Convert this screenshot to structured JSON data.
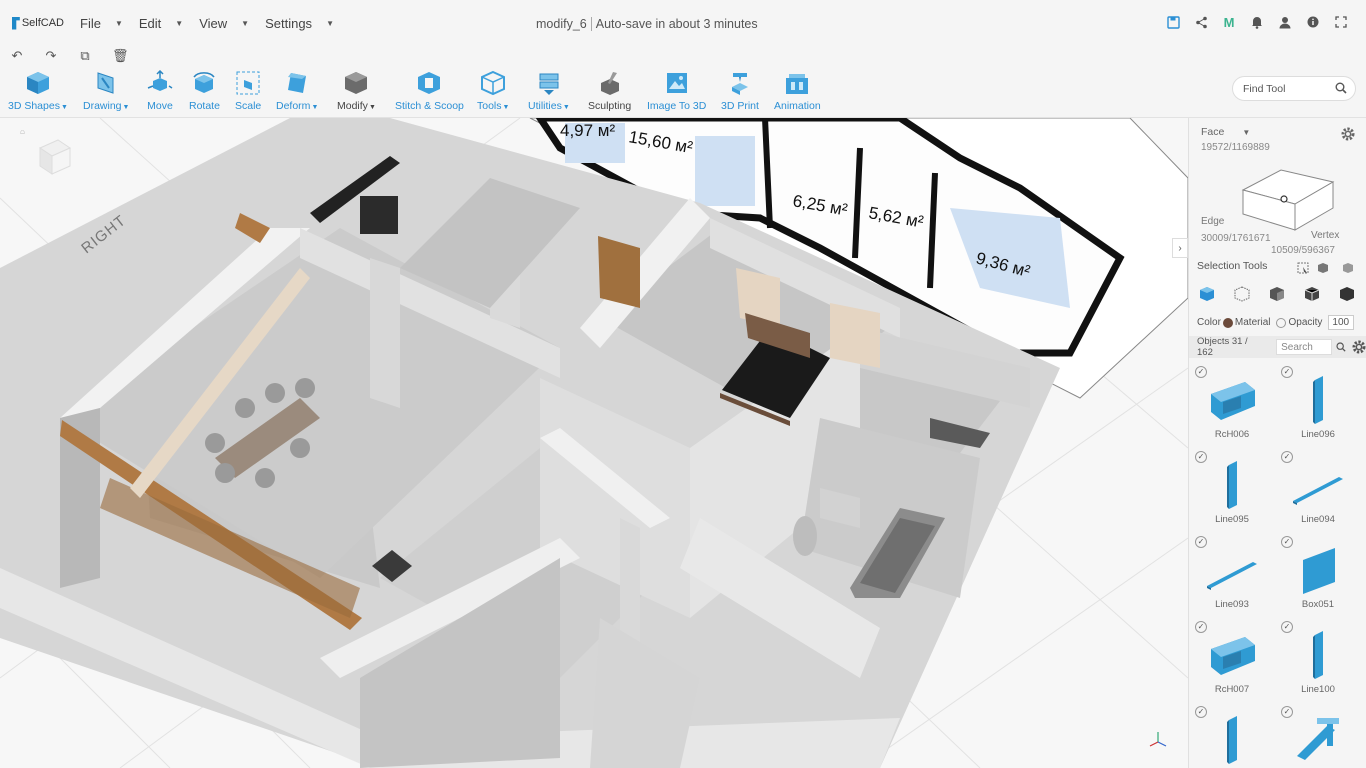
{
  "app": {
    "logo_text": "SelfCAD"
  },
  "menus": [
    {
      "label": "File"
    },
    {
      "label": "Edit"
    },
    {
      "label": "View"
    },
    {
      "label": "Settings"
    }
  ],
  "document": {
    "name": "modify_6",
    "autosave": "Auto-save in about 3 minutes"
  },
  "top_icons": [
    "save-icon",
    "share-icon",
    "m-icon",
    "bell-icon",
    "user-icon",
    "info-icon",
    "fullscreen-icon"
  ],
  "undo_icons": [
    "undo-icon",
    "redo-icon",
    "copy-icon",
    "trash-icon"
  ],
  "toolbar": {
    "tools": [
      {
        "label": "3D Shapes",
        "dropdown": true
      },
      {
        "label": "Drawing",
        "dropdown": true
      },
      {
        "label": "Move",
        "dropdown": false
      },
      {
        "label": "Rotate",
        "dropdown": false
      },
      {
        "label": "Scale",
        "dropdown": false
      },
      {
        "label": "Deform",
        "dropdown": true
      },
      {
        "label": "Modify",
        "dropdown": true
      },
      {
        "label": "Stitch & Scoop",
        "dropdown": false
      },
      {
        "label": "Tools",
        "dropdown": true
      },
      {
        "label": "Utilities",
        "dropdown": true
      },
      {
        "label": "Sculpting",
        "dropdown": false
      },
      {
        "label": "Image To 3D",
        "dropdown": false
      },
      {
        "label": "3D Print",
        "dropdown": false
      },
      {
        "label": "Animation",
        "dropdown": false
      }
    ],
    "find_placeholder": "Find Tool"
  },
  "viewport": {
    "cube_label": "RIGHT",
    "floorplan_labels": [
      "4,97 м²",
      "15,60 м²",
      "6,25 м²",
      "5,62 м²",
      "9,36 м²"
    ],
    "axis_label": "xyz"
  },
  "panel": {
    "mode": "Face",
    "face_count": "19572/1169889",
    "edge_label": "Edge",
    "edge_count": "30009/1761671",
    "vertex_label": "Vertex",
    "vertex_count": "10509/596367",
    "selection_tools_label": "Selection Tools",
    "color_label": "Color",
    "material_label": "Material",
    "opacity_label": "Opacity",
    "opacity_value": "100",
    "objects_count": "Objects 31 / 162",
    "search_placeholder": "Search",
    "colors": {
      "accent": "#2b8fd4",
      "object": "#2f9bd3"
    },
    "objects": [
      {
        "name": "RcH006",
        "shape": "box"
      },
      {
        "name": "Line096",
        "shape": "vplate"
      },
      {
        "name": "Line095",
        "shape": "vplate"
      },
      {
        "name": "Line094",
        "shape": "flat"
      },
      {
        "name": "Line093",
        "shape": "flat"
      },
      {
        "name": "Box051",
        "shape": "panel"
      },
      {
        "name": "RcH007",
        "shape": "box"
      },
      {
        "name": "Line100",
        "shape": "vplate"
      },
      {
        "name": "",
        "shape": "vplate"
      },
      {
        "name": "",
        "shape": "multi"
      }
    ]
  }
}
